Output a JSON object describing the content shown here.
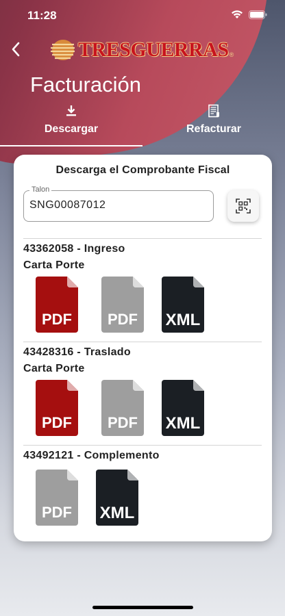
{
  "status_bar": {
    "time": "11:28"
  },
  "header": {
    "brand": "TRESGUERRAS",
    "brand_mark": "®",
    "title": "Facturación"
  },
  "tabs": [
    {
      "label": "Descargar",
      "icon": "download-icon",
      "active": true
    },
    {
      "label": "Refacturar",
      "icon": "receipt-icon",
      "active": false
    }
  ],
  "card": {
    "title": "Descarga el Comprobante Fiscal",
    "talon": {
      "label": "Talon",
      "value": "SNG00087012"
    }
  },
  "documents": [
    {
      "title": "43362058 - Ingreso",
      "subtitle": "Carta Porte",
      "files": [
        "PDF",
        "PDF",
        "XML"
      ]
    },
    {
      "title": "43428316 - Traslado",
      "subtitle": "Carta Porte",
      "files": [
        "PDF",
        "PDF",
        "XML"
      ]
    },
    {
      "title": "43492121 - Complemento",
      "subtitle": "",
      "files": [
        "PDF",
        "XML"
      ]
    }
  ],
  "colors": {
    "pdf_red": "#a50f0f",
    "pdf_gray": "#9e9e9e",
    "xml_dark": "#1b1f24",
    "brand_red": "#c8141e"
  }
}
